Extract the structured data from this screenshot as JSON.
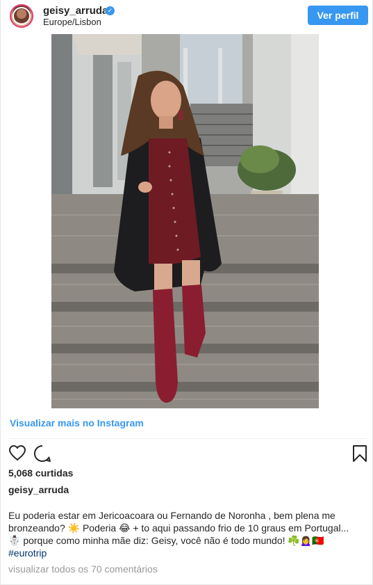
{
  "post": {
    "username": "geisy_arruda",
    "verified_mark": "✓",
    "location": "Europe/Lisbon",
    "follow_label": "Ver perfil",
    "view_more_label": "Visualizar mais no Instagram",
    "likes_text": "5,068 curtidas",
    "caption_user": "geisy_arruda",
    "caption_lines": [
      "Eu poderia estar em Jericoacoara ou Fernando de Noronha , bem plena me",
      "bronzeando? ☀️  Poderia 😂 + to aqui passando frio de 10 graus em Portugal...",
      "☃️  porque como minha mãe diz: Geisy, você não é todo mundo! ☘️🙍‍♀️🇵🇹"
    ],
    "hashtag": "#eurotrip",
    "all_comments_label": "visualizar todos os 70 comentários"
  },
  "icons": {
    "heart": "heart-icon",
    "comment": "comment-icon",
    "save": "bookmark-icon",
    "verified": "verified-badge-icon"
  },
  "colors": {
    "accent": "#3897f0",
    "text": "#262626",
    "muted": "#999999",
    "hashtag": "#003569"
  }
}
